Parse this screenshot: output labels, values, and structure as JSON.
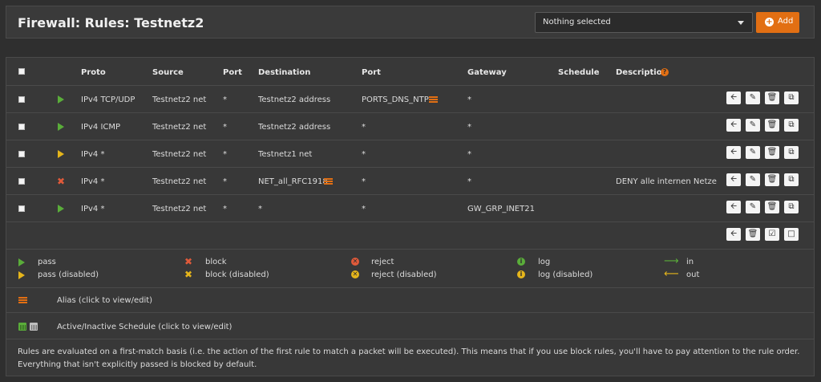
{
  "header": {
    "title": "Firewall: Rules: Testnetz2",
    "select_value": "Nothing selected",
    "add_label": "Add"
  },
  "table": {
    "columns": [
      "Proto",
      "Source",
      "Port",
      "Destination",
      "Port",
      "Gateway",
      "Schedule",
      "Description"
    ],
    "rows": [
      {
        "action": "pass",
        "proto": "IPv4 TCP/UDP",
        "source": "Testnetz2 net",
        "src_port": "*",
        "destination": "Testnetz2 address",
        "dst_port": "PORTS_DNS_NTP",
        "gateway": "*",
        "schedule": "",
        "description": ""
      },
      {
        "action": "pass",
        "proto": "IPv4 ICMP",
        "source": "Testnetz2 net",
        "src_port": "*",
        "destination": "Testnetz2 address",
        "dst_port": "*",
        "gateway": "*",
        "schedule": "",
        "description": ""
      },
      {
        "action": "pass (disabled)",
        "proto": "IPv4 *",
        "source": "Testnetz2 net",
        "src_port": "*",
        "destination": "Testnetz1 net",
        "dst_port": "*",
        "gateway": "*",
        "schedule": "",
        "description": ""
      },
      {
        "action": "block",
        "proto": "IPv4 *",
        "source": "Testnetz2 net",
        "src_port": "*",
        "destination": "NET_all_RFC1918",
        "dst_port": "*",
        "gateway": "*",
        "schedule": "",
        "description": "DENY alle internen Netze"
      },
      {
        "action": "pass",
        "proto": "IPv4 *",
        "source": "Testnetz2 net",
        "src_port": "*",
        "destination": "*",
        "dst_port": "*",
        "gateway": "GW_GRP_INET21",
        "schedule": "",
        "description": ""
      }
    ]
  },
  "legend": {
    "pass": "pass",
    "pass_disabled": "pass (disabled)",
    "block": "block",
    "block_disabled": "block (disabled)",
    "reject": "reject",
    "reject_disabled": "reject (disabled)",
    "log": "log",
    "log_disabled": "log (disabled)",
    "in": "in",
    "out": "out",
    "alias": "Alias (click to view/edit)",
    "schedule": "Active/Inactive Schedule (click to view/edit)"
  },
  "footer_note": "Rules are evaluated on a first-match basis (i.e. the action of the first rule to match a packet will be executed). This means that if you use block rules, you'll have to pay attention to the rule order. Everything that isn't explicitly passed is blocked by default.",
  "colors": {
    "accent": "#e26f13",
    "pass": "#5aad3a",
    "disabled": "#e5b51b",
    "block": "#e05a3a"
  }
}
